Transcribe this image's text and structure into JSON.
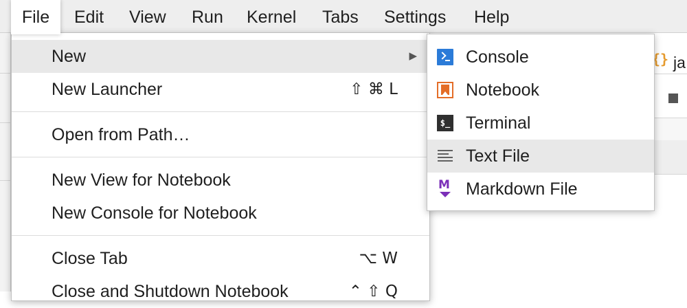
{
  "menubar": {
    "items": [
      {
        "label": "File"
      },
      {
        "label": "Edit"
      },
      {
        "label": "View"
      },
      {
        "label": "Run"
      },
      {
        "label": "Kernel"
      },
      {
        "label": "Tabs"
      },
      {
        "label": "Settings"
      },
      {
        "label": "Help"
      }
    ],
    "active": "File"
  },
  "background": {
    "tab_label_partial": "ja",
    "tab_icon_glyph": "{}"
  },
  "file_menu": {
    "items": [
      {
        "label": "New",
        "shortcut": "",
        "has_submenu": true
      },
      {
        "label": "New Launcher",
        "shortcut": "⇧ ⌘ L"
      },
      {
        "label": "Open from Path…",
        "shortcut": ""
      },
      {
        "label": "New View for Notebook",
        "shortcut": ""
      },
      {
        "label": "New Console for Notebook",
        "shortcut": ""
      },
      {
        "label": "Close Tab",
        "shortcut": "⌥ W"
      },
      {
        "label": "Close and Shutdown Notebook",
        "shortcut": "⌃ ⇧ Q"
      }
    ],
    "submenu_arrow": "▶"
  },
  "new_submenu": {
    "items": [
      {
        "label": "Console",
        "icon": "console-icon"
      },
      {
        "label": "Notebook",
        "icon": "notebook-icon"
      },
      {
        "label": "Terminal",
        "icon": "terminal-icon",
        "glyph": "$_"
      },
      {
        "label": "Text File",
        "icon": "text-file-icon"
      },
      {
        "label": "Markdown File",
        "icon": "markdown-icon",
        "glyph": "M"
      }
    ],
    "hovered": "Text File"
  },
  "colors": {
    "menubar_bg": "#eeeeee",
    "hover_bg": "#e8e8e8",
    "console_icon": "#2b7bd8",
    "notebook_icon": "#e46d27",
    "terminal_icon": "#2f2f2f",
    "markdown_icon": "#7b2fb8",
    "json_tab_icon": "#e59a2d"
  }
}
